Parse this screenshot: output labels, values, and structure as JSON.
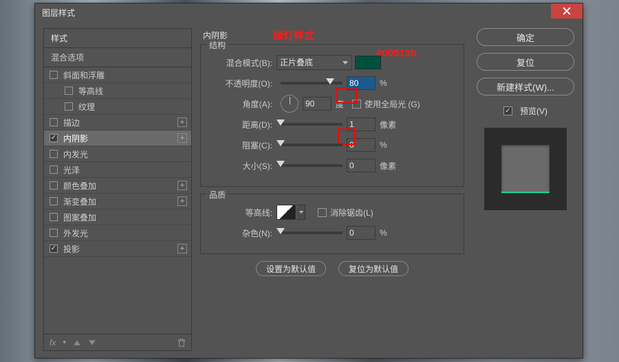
{
  "window": {
    "title": "图层样式"
  },
  "annotations": {
    "style_name": "绿灯样式",
    "hex": "#00513b"
  },
  "sidebar": {
    "header": "样式",
    "sub": "混合选项",
    "items": [
      {
        "label": "斜面和浮雕",
        "checked": false,
        "plus": false
      },
      {
        "label": "等高线",
        "checked": false,
        "indent": true
      },
      {
        "label": "纹理",
        "checked": false,
        "indent": true
      },
      {
        "label": "描边",
        "checked": false,
        "plus": true
      },
      {
        "label": "内阴影",
        "checked": true,
        "plus": true,
        "selected": true
      },
      {
        "label": "内发光",
        "checked": false
      },
      {
        "label": "光泽",
        "checked": false
      },
      {
        "label": "颜色叠加",
        "checked": false,
        "plus": true
      },
      {
        "label": "渐变叠加",
        "checked": false,
        "plus": true
      },
      {
        "label": "图案叠加",
        "checked": false
      },
      {
        "label": "外发光",
        "checked": false
      },
      {
        "label": "投影",
        "checked": true,
        "plus": true
      }
    ],
    "footer_fx": "fx"
  },
  "panel": {
    "title": "内阴影",
    "struct_legend": "结构",
    "blend_mode_label": "混合模式(B):",
    "blend_mode_value": "正片叠底",
    "swatch_color": "#00513b",
    "opacity_label": "不透明度(O):",
    "opacity_value": "80",
    "opacity_unit": "%",
    "angle_label": "角度(A):",
    "angle_value": "90",
    "angle_unit": "度",
    "global_light_label": "使用全局光 (G)",
    "global_light_checked": false,
    "distance_label": "距离(D):",
    "distance_value": "1",
    "distance_unit": "像素",
    "choke_label": "阻塞(C):",
    "choke_value": "0",
    "choke_unit": "%",
    "size_label": "大小(S):",
    "size_value": "0",
    "size_unit": "像素",
    "quality_legend": "品质",
    "contour_label": "等高线:",
    "antialias_label": "消除锯齿(L)",
    "noise_label": "杂色(N):",
    "noise_value": "0",
    "noise_unit": "%",
    "make_default": "设置为默认值",
    "reset_default": "复位为默认值"
  },
  "right": {
    "ok": "确定",
    "reset": "复位",
    "new_style": "新建样式(W)...",
    "preview": "预览(V)"
  }
}
